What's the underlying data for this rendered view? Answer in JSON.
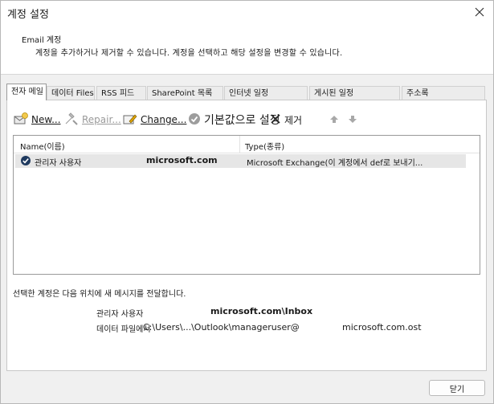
{
  "window": {
    "title": "계정 설정",
    "close_icon": "close-icon"
  },
  "header": {
    "title": "Email 계정",
    "description": "계정을 추가하거나 제거할 수 있습니다. 계정을 선택하고 해당 설정을 변경할 수 있습니다."
  },
  "tabs": [
    {
      "label": "전자 메일",
      "active": true
    },
    {
      "label": "데이터 Files",
      "active": false
    },
    {
      "label": "RSS 피드",
      "active": false
    },
    {
      "label": "SharePoint 목록",
      "active": false
    },
    {
      "label": "인터넷 일정",
      "active": false
    },
    {
      "label": "게시된 일정",
      "active": false
    },
    {
      "label": "주소록",
      "active": false
    }
  ],
  "toolbar": {
    "new_label": "New...",
    "repair_label": "Repair...",
    "change_label": "Change...",
    "default_label": "기본값으로 설정",
    "remove_label": "제거",
    "icons": [
      "new-account-icon",
      "repair-icon",
      "change-icon",
      "set-default-icon",
      "remove-icon",
      "move-up-icon",
      "move-down-icon"
    ]
  },
  "list": {
    "columns": [
      "Name(이름)",
      "Type(종류)"
    ],
    "rows": [
      {
        "name": "관리자 사용자",
        "domain": "microsoft.com",
        "type": "Microsoft Exchange(이 계정에서 def로 보내기..."
      }
    ]
  },
  "delivery": {
    "text": "선택한 계정은 다음 위치에 새 메시지를 전달합니다.",
    "folder_label": "관리자 사용자",
    "folder_value": "microsoft.com\\Inbox",
    "datafile_label": "데이터 파일에서",
    "datafile_path": "C:\\Users\\...\\Outlook\\manageruser@",
    "datafile_ost": "microsoft.com.ost"
  },
  "footer": {
    "close_label": "닫기"
  },
  "colors": {
    "window_bg": "#f0f0f0",
    "panel_bg": "#ffffff",
    "selected_row": "#e6e6e6",
    "disabled_text": "#9a9a9a"
  }
}
